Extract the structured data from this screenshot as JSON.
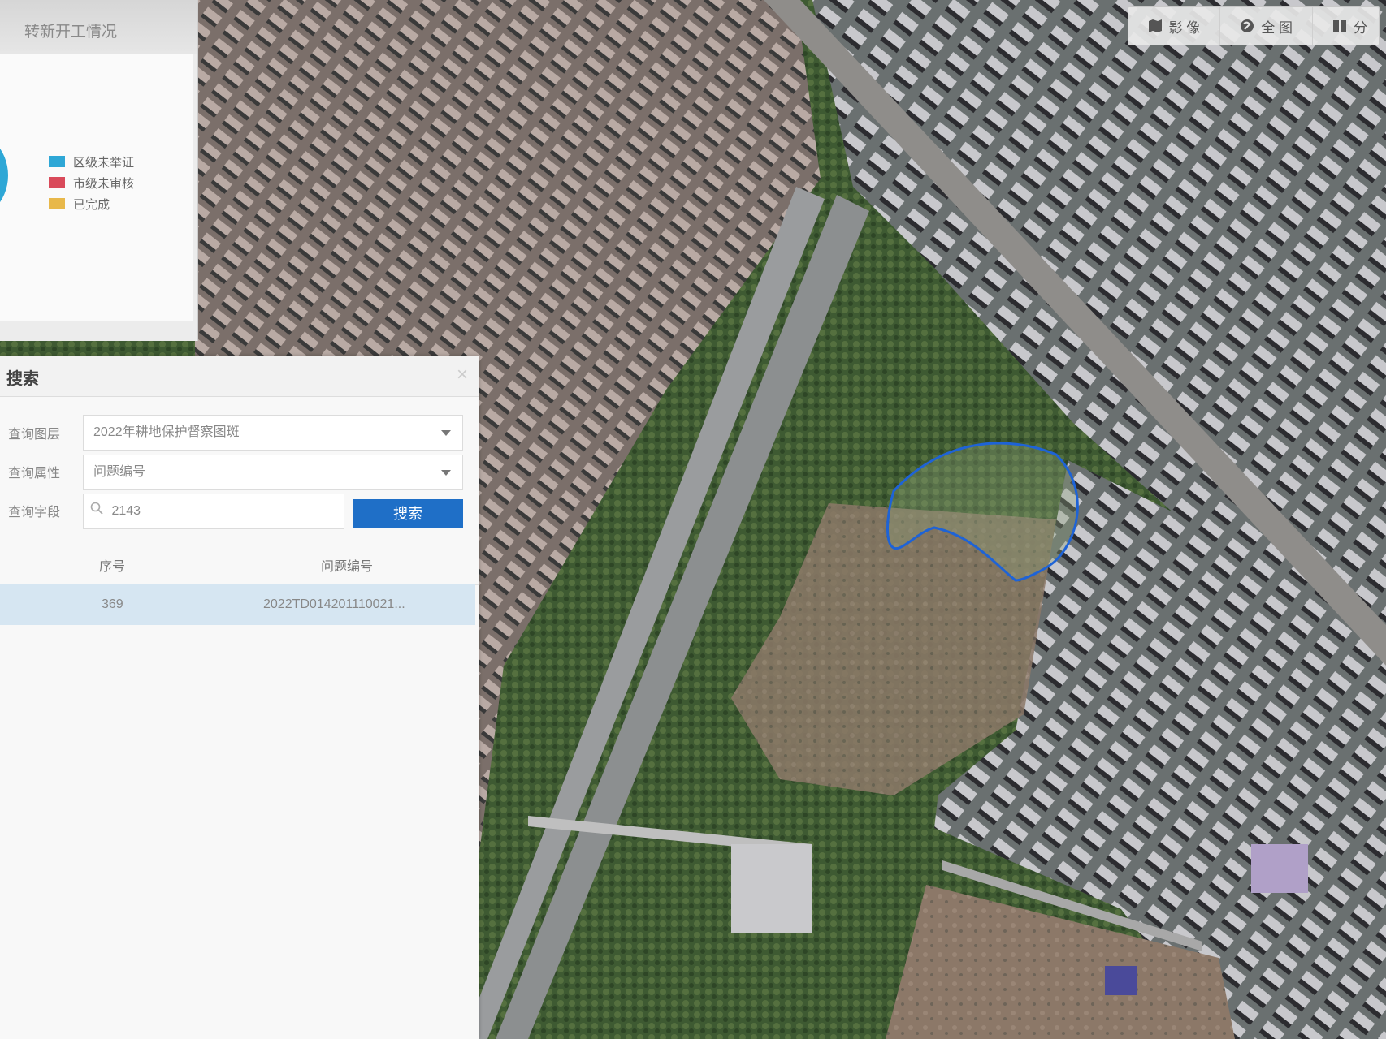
{
  "toolbar": {
    "items": [
      {
        "icon": "map-icon",
        "label": "影 像"
      },
      {
        "icon": "globe-icon",
        "label": "全 图"
      },
      {
        "icon": "split-icon",
        "label": "分"
      }
    ]
  },
  "stats": {
    "title": "转新开工情况",
    "legend": [
      {
        "label": "区级未举证",
        "color": "#2ea7d6"
      },
      {
        "label": "市级未审核",
        "color": "#d94a5a"
      },
      {
        "label": "已完成",
        "color": "#e8b84a"
      }
    ]
  },
  "search": {
    "title": "搜索",
    "layer_label": "查询图层",
    "layer_value": "2022年耕地保护督察图斑",
    "attr_label": "查询属性",
    "attr_value": "问题编号",
    "field_label": "查询字段",
    "field_value": "2143",
    "button": "搜索",
    "columns": [
      "序号",
      "问题编号"
    ],
    "rows": [
      {
        "index": "369",
        "code": "2022TD014201110021..."
      }
    ]
  },
  "colors": {
    "accent": "#1f6fc7",
    "boundary": "#1e63d6",
    "selected_row": "#d6e6f2"
  }
}
